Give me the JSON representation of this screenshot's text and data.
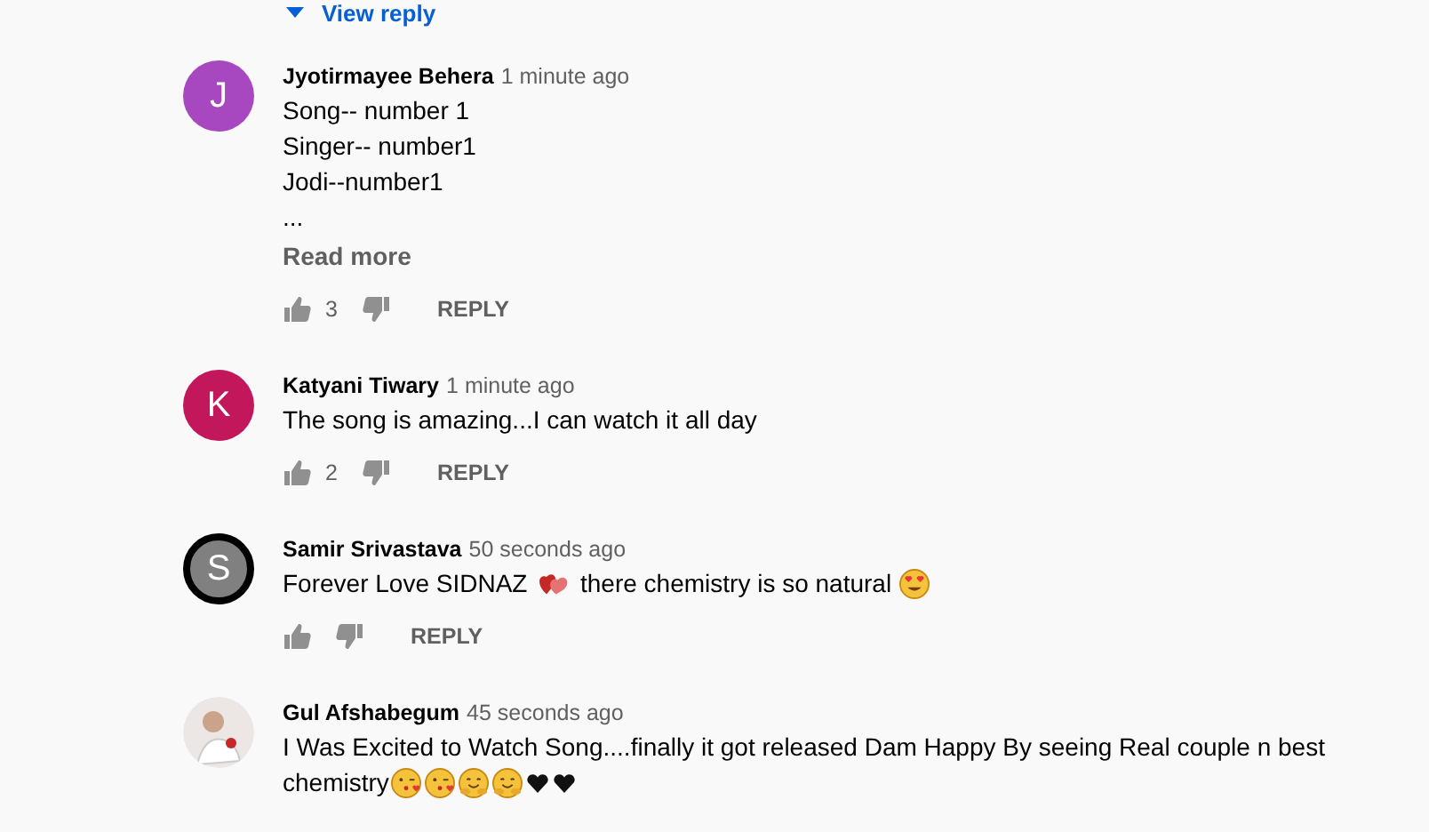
{
  "view_replies": {
    "label": "View reply"
  },
  "comments": [
    {
      "avatar": {
        "kind": "letter",
        "letter": "J",
        "color": "#a748c0"
      },
      "author": "Jyotirmayee Behera",
      "time": "1 minute ago",
      "lines": [
        [
          {
            "kind": "text",
            "text": "Song-- number 1"
          }
        ],
        [
          {
            "kind": "text",
            "text": "Singer-- number1"
          }
        ],
        [
          {
            "kind": "text",
            "text": "Jodi--number1"
          }
        ],
        [
          {
            "kind": "text",
            "text": "..."
          }
        ]
      ],
      "read_more": "Read more",
      "likes": "3",
      "reply": "REPLY"
    },
    {
      "avatar": {
        "kind": "letter",
        "letter": "K",
        "color": "#c2185b"
      },
      "author": "Katyani Tiwary",
      "time": "1 minute ago",
      "lines": [
        [
          {
            "kind": "text",
            "text": "The song is amazing...I can watch it all day"
          }
        ]
      ],
      "likes": "2",
      "reply": "REPLY"
    },
    {
      "avatar": {
        "kind": "ring",
        "letter": "S",
        "color": "#808080"
      },
      "author": "Samir Srivastava",
      "time": "50 seconds ago",
      "lines": [
        [
          {
            "kind": "text",
            "text": "Forever Love SIDNAZ "
          },
          {
            "kind": "hearts"
          },
          {
            "kind": "text",
            "text": " there chemistry is so natural "
          },
          {
            "kind": "heart-eyes"
          }
        ]
      ],
      "reply": "REPLY"
    },
    {
      "avatar": {
        "kind": "photo"
      },
      "author": "Gul Afshabegum",
      "time": "45 seconds ago",
      "lines": [
        [
          {
            "kind": "text",
            "text": "I Was Excited to Watch Song....finally it got released Dam Happy By seeing Real couple n best"
          }
        ],
        [
          {
            "kind": "text",
            "text": "chemistry"
          },
          {
            "kind": "kiss"
          },
          {
            "kind": "kiss"
          },
          {
            "kind": "hug"
          },
          {
            "kind": "hug"
          },
          {
            "kind": "black-heart"
          },
          {
            "kind": "black-heart"
          }
        ]
      ]
    }
  ]
}
